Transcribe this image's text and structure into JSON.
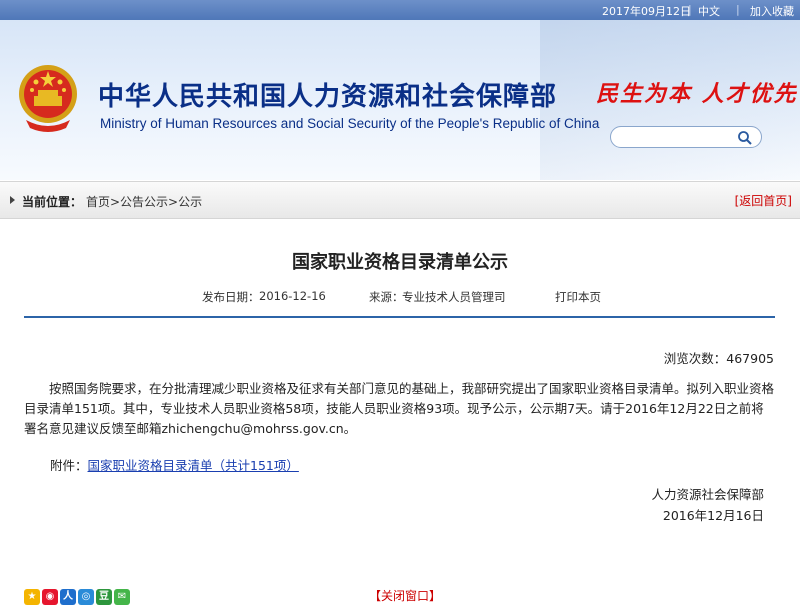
{
  "topbar": {
    "date": "2017年09月12日",
    "lang": "中文",
    "favorite": "加入收藏"
  },
  "header": {
    "title_cn": "中华人民共和国人力资源和社会保障部",
    "title_en": "Ministry of Human Resources and Social Security of the People's Republic of China",
    "slogan": "民生为本 人才优先",
    "search": {
      "value": "",
      "placeholder": ""
    }
  },
  "breadcrumb": {
    "label": "当前位置：",
    "path": "首页>公告公示>公示",
    "back": "[返回首页]"
  },
  "article": {
    "title": "国家职业资格目录清单公示",
    "date_label": "发布日期：",
    "date": "2016-12-16",
    "source_label": "来源：",
    "source": "专业技术人员管理司",
    "print": "打印本页",
    "views_label": "浏览次数：",
    "views": "467905",
    "body": "按照国务院要求，在分批清理减少职业资格及征求有关部门意见的基础上，我部研究提出了国家职业资格目录清单。拟列入职业资格目录清单151项。其中，专业技术人员职业资格58项，技能人员职业资格93项。现予公示，公示期7天。请于2016年12月22日之前将署名意见建议反馈至邮箱zhichengchu@mohrss.gov.cn。",
    "attachment_label": "附件：",
    "attachment_link": "国家职业资格目录清单（共计151项）",
    "signer": "人力资源社会保障部",
    "sign_date": "2016年12月16日"
  },
  "footer": {
    "close": "【关闭窗口】",
    "share_icons": [
      "qzone-icon",
      "weibo-icon",
      "renren-icon",
      "tencent-weibo-icon",
      "douban-icon",
      "wechat-icon"
    ]
  },
  "colors": {
    "topbar": "#4f77b8",
    "title_blue": "#0a2f87",
    "accent_red": "#cc0000",
    "rule_blue": "#2c64a8"
  }
}
